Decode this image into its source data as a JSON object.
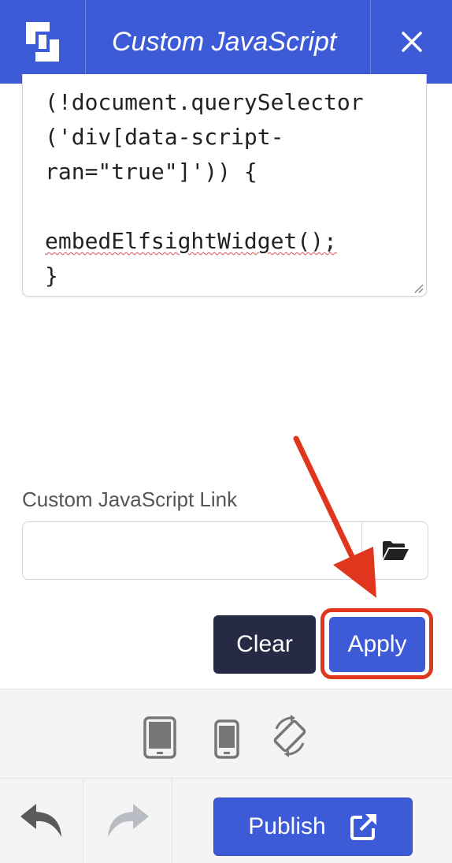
{
  "header": {
    "title": "Custom JavaScript",
    "logo_icon": "brand-logo-icon",
    "close_icon": "close-icon"
  },
  "editor": {
    "lines": [
      "(!document.querySelector",
      "('div[data-script-",
      "ran=\"true\"]')) {",
      "",
      "embedElfsightWidget();",
      "}"
    ]
  },
  "link_field": {
    "label": "Custom JavaScript Link",
    "value": "",
    "placeholder": "",
    "browse_icon": "folder-open-icon"
  },
  "actions": {
    "clear_label": "Clear",
    "apply_label": "Apply",
    "highlight_color": "#e0361e"
  },
  "device_bar": {
    "icons": [
      "tablet-icon",
      "phone-icon",
      "rotate-device-icon"
    ]
  },
  "bottom_bar": {
    "undo_icon": "undo-icon",
    "redo_icon": "redo-icon",
    "publish_label": "Publish",
    "publish_icon": "external-link-icon"
  },
  "colors": {
    "primary": "#3d5bd6",
    "dark_button": "#262a45",
    "annotation": "#e0361e"
  }
}
